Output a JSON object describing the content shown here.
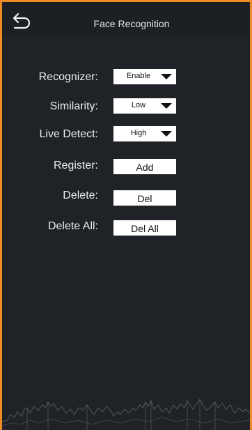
{
  "header": {
    "title": "Face Recognition"
  },
  "settings": {
    "recognizer": {
      "label": "Recognizer:",
      "value": "Enable"
    },
    "similarity": {
      "label": "Similarity:",
      "value": "Low"
    },
    "live_detect": {
      "label": "Live Detect:",
      "value": "High"
    },
    "register": {
      "label": "Register:",
      "button": "Add"
    },
    "delete": {
      "label": "Delete:",
      "button": "Del"
    },
    "delete_all": {
      "label": "Delete All:",
      "button": "Del All"
    }
  },
  "icons": {
    "back": "back-arrow-icon",
    "dropdown": "caret-down-icon"
  },
  "colors": {
    "accent_border": "#f08a24",
    "background": "#1f2226",
    "control_bg": "#ffffff"
  }
}
